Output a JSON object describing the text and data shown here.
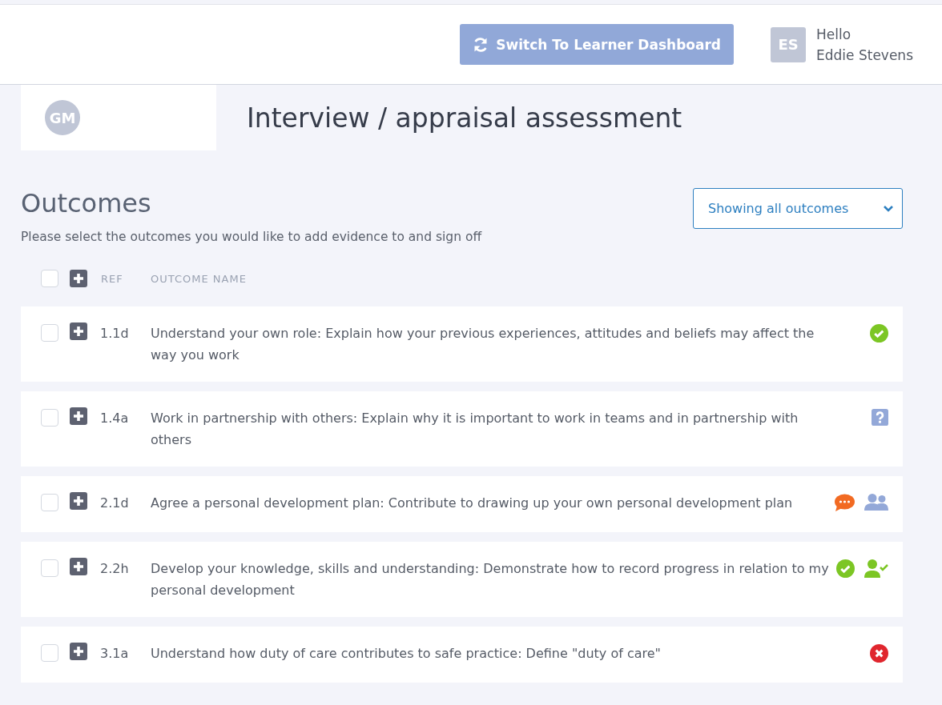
{
  "header": {
    "switch_button": "Switch To Learner Dashboard",
    "greeting": "Hello",
    "user_name": "Eddie Stevens",
    "user_initials": "ES"
  },
  "assessment": {
    "avatar_initials": "GM",
    "title": "Interview / appraisal assessment"
  },
  "outcomes": {
    "heading": "Outcomes",
    "subtitle": "Please select the outcomes you would like to add evidence to and sign off",
    "filter": "Showing all outcomes",
    "header": {
      "checked": false,
      "ref": "REF",
      "name": "OUTCOME NAME"
    },
    "rows": [
      {
        "checked": false,
        "ref": "1.1d",
        "name": "Understand your own role: Explain how your previous experiences, attitudes and beliefs may affect the way you work",
        "statuses": [
          {
            "kind": "complete"
          }
        ]
      },
      {
        "checked": false,
        "ref": "1.4a",
        "name": "Work in partnership with others: Explain why it is important to work in teams and in partnership with others",
        "statuses": [
          {
            "kind": "query"
          }
        ]
      },
      {
        "checked": false,
        "ref": "2.1d",
        "name": "Agree a personal development plan: Contribute to drawing up your own personal development plan",
        "statuses": [
          {
            "kind": "comment"
          },
          {
            "kind": "group"
          }
        ]
      },
      {
        "checked": false,
        "ref": "2.2h",
        "name": "Develop your knowledge, skills and understanding: Demonstrate how to record progress in relation to my personal development",
        "statuses": [
          {
            "kind": "complete"
          },
          {
            "kind": "signed"
          }
        ]
      },
      {
        "checked": false,
        "ref": "3.1a",
        "name": "Understand how duty of care contributes to safe practice: Define \"duty of care\"",
        "statuses": [
          {
            "kind": "rejected"
          }
        ]
      }
    ]
  }
}
